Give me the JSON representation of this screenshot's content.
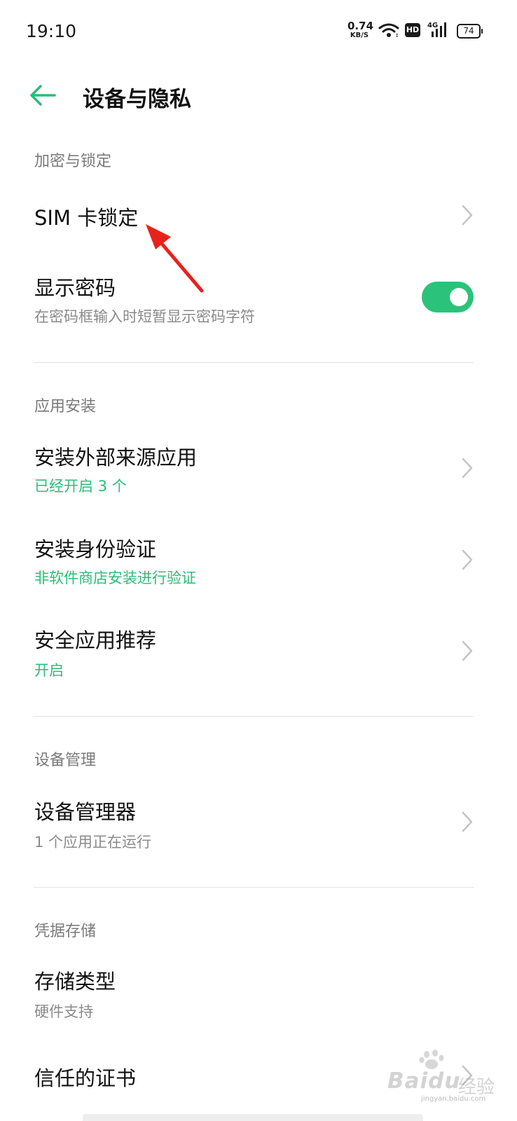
{
  "status_bar": {
    "time": "19:10",
    "net_speed_value": "0.74",
    "net_speed_unit": "KB/S",
    "hd_badge": "HD",
    "network_type": "4G",
    "battery_level": "74",
    "icons": [
      "wifi-icon",
      "hd-icon",
      "signal-icon",
      "battery-icon"
    ]
  },
  "header": {
    "title": "设备与隐私",
    "back_icon": "arrow-left-icon"
  },
  "sections": {
    "encryption": {
      "heading": "加密与锁定",
      "sim_lock": {
        "title": "SIM 卡锁定"
      },
      "show_password": {
        "title": "显示密码",
        "subtitle": "在密码框输入时短暂显示密码字符",
        "toggle_on": true
      }
    },
    "app_install": {
      "heading": "应用安装",
      "external_sources": {
        "title": "安装外部来源应用",
        "subtitle": "已经开启 3 个"
      },
      "install_verification": {
        "title": "安装身份验证",
        "subtitle": "非软件商店安装进行验证"
      },
      "security_recommend": {
        "title": "安全应用推荐",
        "subtitle": "开启"
      }
    },
    "device_management": {
      "heading": "设备管理",
      "device_admin": {
        "title": "设备管理器",
        "subtitle": "1 个应用正在运行"
      }
    },
    "credential_storage": {
      "heading": "凭据存储",
      "storage_type": {
        "title": "存储类型",
        "subtitle": "硬件支持"
      },
      "trusted_certs": {
        "title": "信任的证书"
      }
    }
  },
  "watermark": {
    "brand": "Baidu",
    "product": "经验",
    "url": "jingyan.baidu.com"
  },
  "colors": {
    "accent_green": "#2bbd78",
    "annotation_red": "#e8221b",
    "section_heading": "#7a7a7a"
  }
}
